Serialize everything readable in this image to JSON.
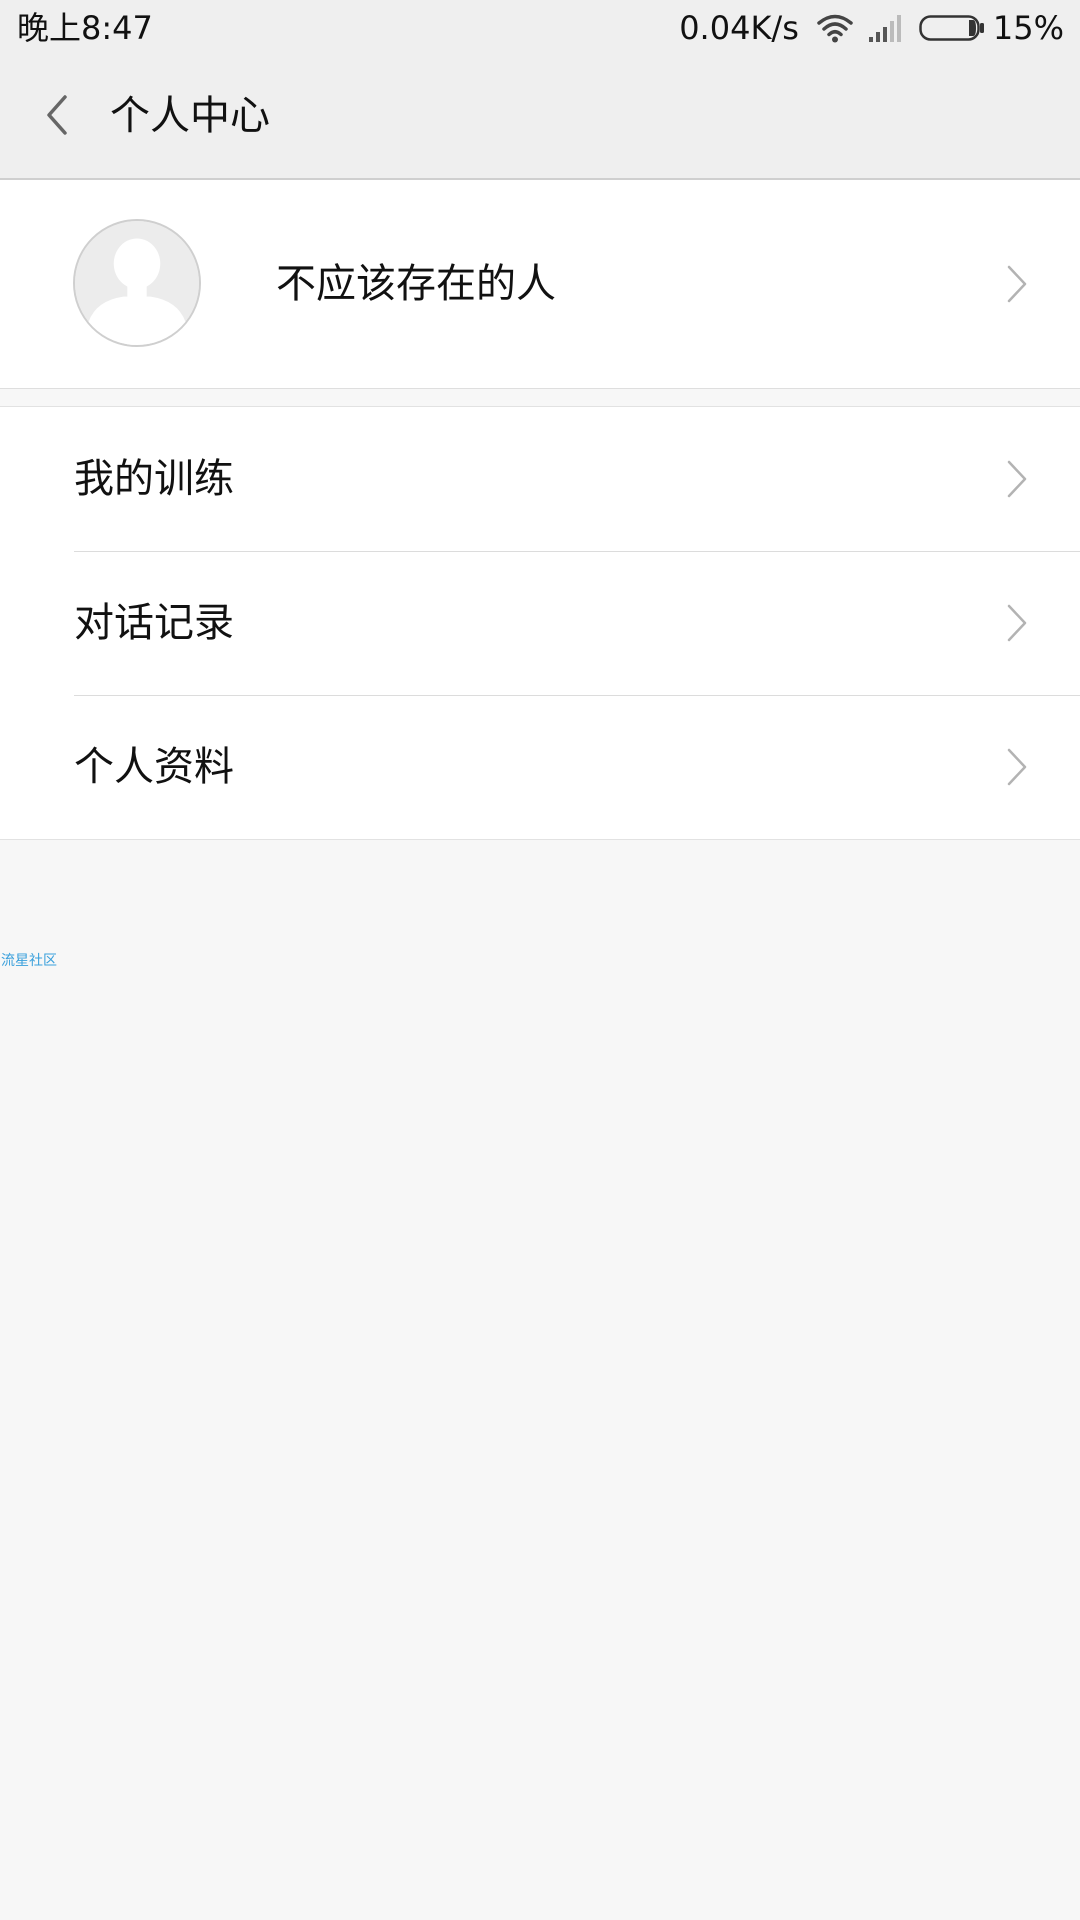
{
  "status_bar": {
    "time": "晚上8:47",
    "net_speed": "0.04K/s",
    "battery": "15%",
    "icons": [
      "wifi-icon",
      "signal-icon",
      "battery-icon"
    ]
  },
  "nav": {
    "title": "个人中心",
    "back_icon": "chevron-left-icon"
  },
  "profile": {
    "name": "不应该存在的人",
    "avatar_icon": "default-user-avatar"
  },
  "menu": {
    "items": [
      {
        "label": "我的训练"
      },
      {
        "label": "对话记录"
      },
      {
        "label": "个人资料"
      }
    ]
  },
  "watermark": "流星社区",
  "colors": {
    "status_bar_bg": "#efefef",
    "content_bg": "#f7f7f7",
    "card_bg": "#ffffff",
    "chevron": "#b3b3b3",
    "watermark": "#3aa0dc"
  }
}
